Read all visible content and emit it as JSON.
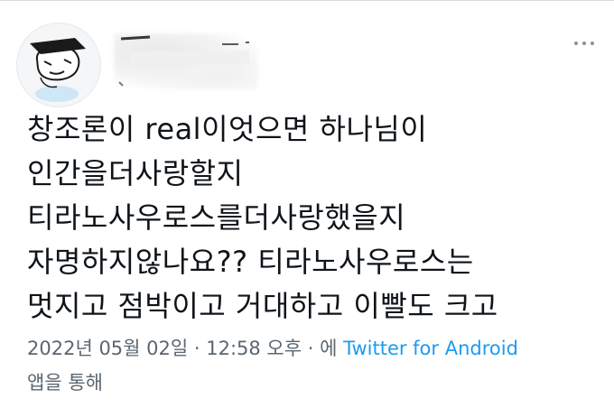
{
  "tweet": {
    "lines": [
      "창조론이 real이엇으면 하나님이",
      "인간을더사랑할지",
      "티라노사우로스를더사랑했을지",
      "자명하지않나요?? 티라노사우로스는",
      "멋지고 점박이고 거대하고 이빨도 크고"
    ]
  },
  "meta": {
    "date": "2022년 05월 02일",
    "separator": " · ",
    "time": "12:58 오후",
    "source_prefix": " · 에 ",
    "source": "Twitter for Android",
    "via": "앱을 통해"
  },
  "icons": {
    "more": "more-horizontal-icon",
    "avatar": "cartoon-avatar"
  },
  "colors": {
    "text": "#0f1419",
    "secondary": "#5b6670",
    "link": "#1d9bf0"
  }
}
